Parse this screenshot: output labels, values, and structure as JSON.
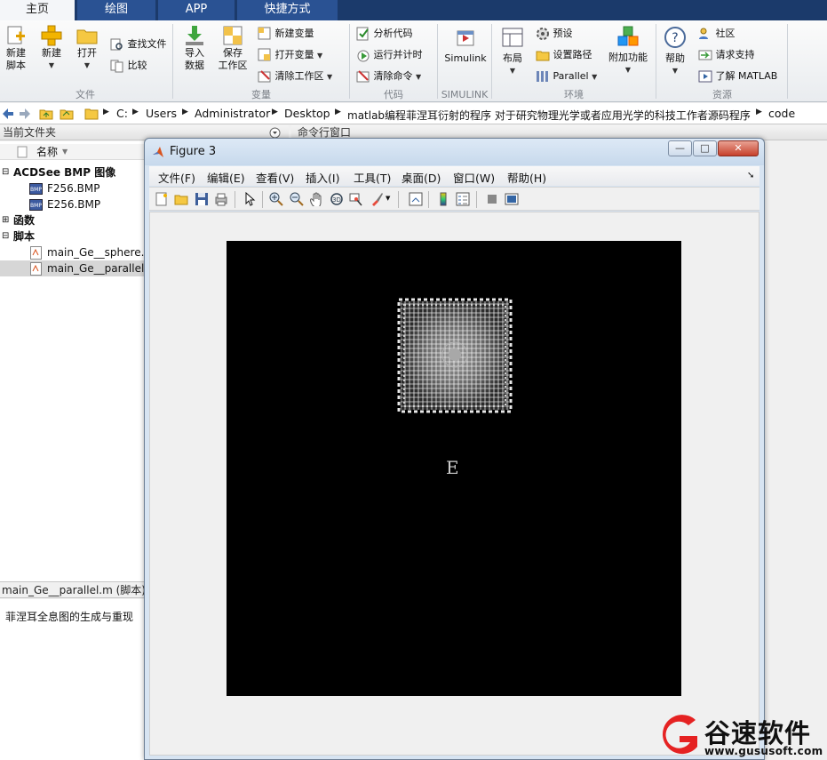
{
  "ribbon_tabs": [
    {
      "label": "主页"
    },
    {
      "label": "绘图"
    },
    {
      "label": "APP"
    },
    {
      "label": "快捷方式"
    }
  ],
  "ribbon": {
    "new_script": "新建\n脚本",
    "new": "新建",
    "open": "打开",
    "find_files": "查找文件",
    "compare": "比较",
    "import_data": "导入\n数据",
    "save_workspace": "保存\n工作区",
    "new_variable": "新建变量",
    "open_variable": "打开变量",
    "clear_workspace": "清除工作区",
    "analyze_code": "分析代码",
    "run_and_time": "运行并计时",
    "clear_commands": "清除命令",
    "simulink": "Simulink",
    "layout": "布局",
    "preferences": "预设",
    "set_path": "设置路径",
    "parallel": "Parallel",
    "addons": "附加功能",
    "help": "帮助",
    "community": "社区",
    "request_support": "请求支持",
    "learn_matlab": "了解 MATLAB",
    "groups": {
      "file": "文件",
      "variable": "变量",
      "code": "代码",
      "simulink": "SIMULINK",
      "environment": "环境",
      "resources": "资源"
    }
  },
  "address": {
    "crumbs": [
      "C:",
      "Users",
      "Administrator",
      "Desktop",
      "matlab编程菲涅耳衍射的程序 对于研究物理光学或者应用光学的科技工作者源码程序",
      "code"
    ]
  },
  "current_folder": {
    "title": "当前文件夹",
    "column_name": "名称",
    "groups": [
      {
        "label": "ACDSee BMP 图像",
        "expanded": true,
        "items": [
          "F256.BMP",
          "E256.BMP"
        ]
      },
      {
        "label": "函数",
        "expanded": false,
        "items": []
      },
      {
        "label": "脚本",
        "expanded": true,
        "items": [
          "main_Ge__sphere.m",
          "main_Ge__parallel.m"
        ]
      }
    ],
    "selected_item": "main_Ge__parallel.m"
  },
  "details": {
    "header": "main_Ge__parallel.m  (脚本)",
    "description": "菲涅耳全息图的生成与重现"
  },
  "command_window": {
    "title": "命令行窗口"
  },
  "figure": {
    "title": "Figure 3",
    "menus": [
      "文件(F)",
      "编辑(E)",
      "查看(V)",
      "插入(I)",
      "工具(T)",
      "桌面(D)",
      "窗口(W)",
      "帮助(H)"
    ],
    "window_buttons": {
      "minimize": "—",
      "maximize": "□",
      "close": "✕"
    },
    "image_letter": "E"
  },
  "watermark": {
    "name": "谷速软件",
    "url": "www.gususoft.com",
    "color": "#e52222"
  }
}
